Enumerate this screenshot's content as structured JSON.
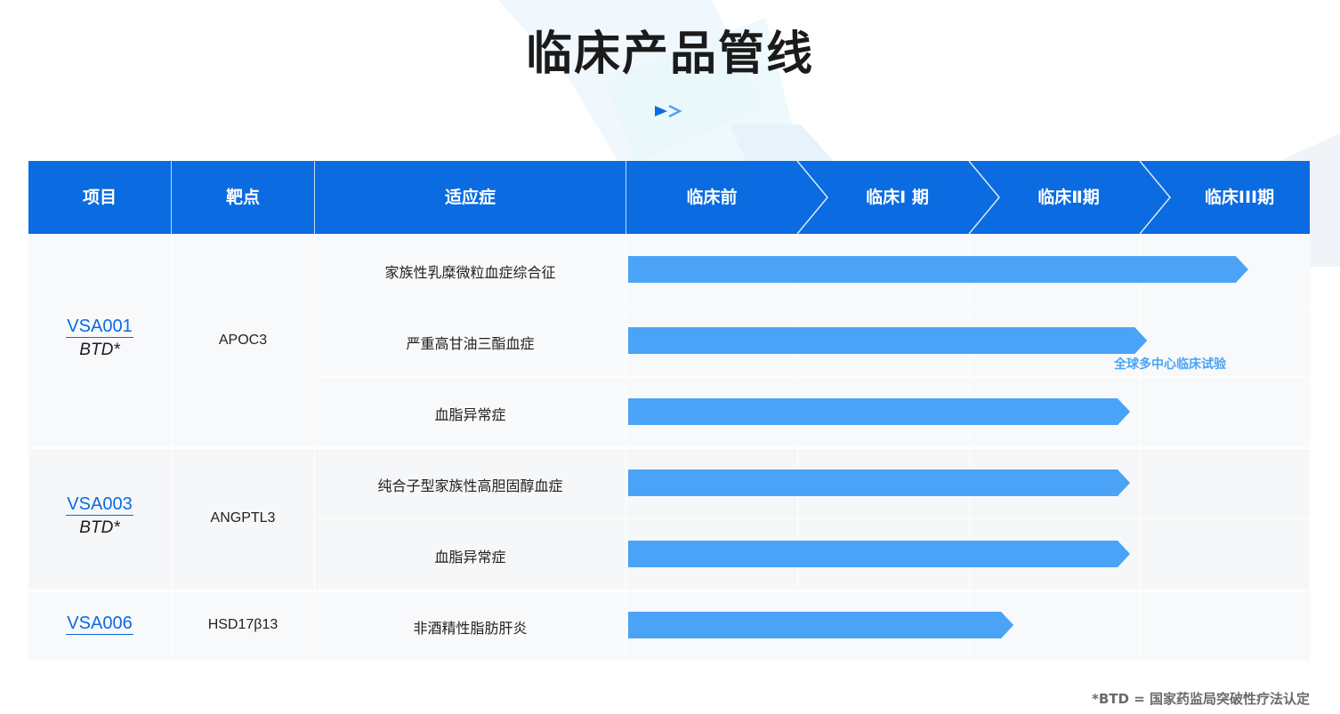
{
  "title": "临床产品管线",
  "colors": {
    "header_bg": "#0b6be1",
    "bar": "#4aa3f6",
    "link": "#0b6be1"
  },
  "header": {
    "project": "项目",
    "target": "靶点",
    "indication": "适应症",
    "phases": [
      "临床前",
      "临床Ⅰ 期",
      "临床Ⅱ期",
      "临床III期"
    ]
  },
  "rows": [
    {
      "project": "VSA001",
      "badge": "BTD*",
      "target": "APOC3",
      "indications": [
        {
          "name": "家族性乳糜微粒血症综合征",
          "progress_phases": 3.62
        },
        {
          "name": "严重高甘油三酯血症",
          "progress_phases": 3.03,
          "note": "全球多中心临床试验"
        },
        {
          "name": "血脂异常症",
          "progress_phases": 2.93
        }
      ]
    },
    {
      "project": "VSA003",
      "badge": "BTD*",
      "target": "ANGPTL3",
      "indications": [
        {
          "name": "纯合子型家族性高胆固醇血症",
          "progress_phases": 2.93
        },
        {
          "name": "血脂异常症",
          "progress_phases": 2.93
        }
      ]
    },
    {
      "project": "VSA006",
      "badge": "",
      "target": "HSD17β13",
      "indications": [
        {
          "name": "非酒精性脂肪肝炎",
          "progress_phases": 2.25
        }
      ]
    }
  ],
  "footnote": "*BTD = 国家药监局突破性疗法认定"
}
